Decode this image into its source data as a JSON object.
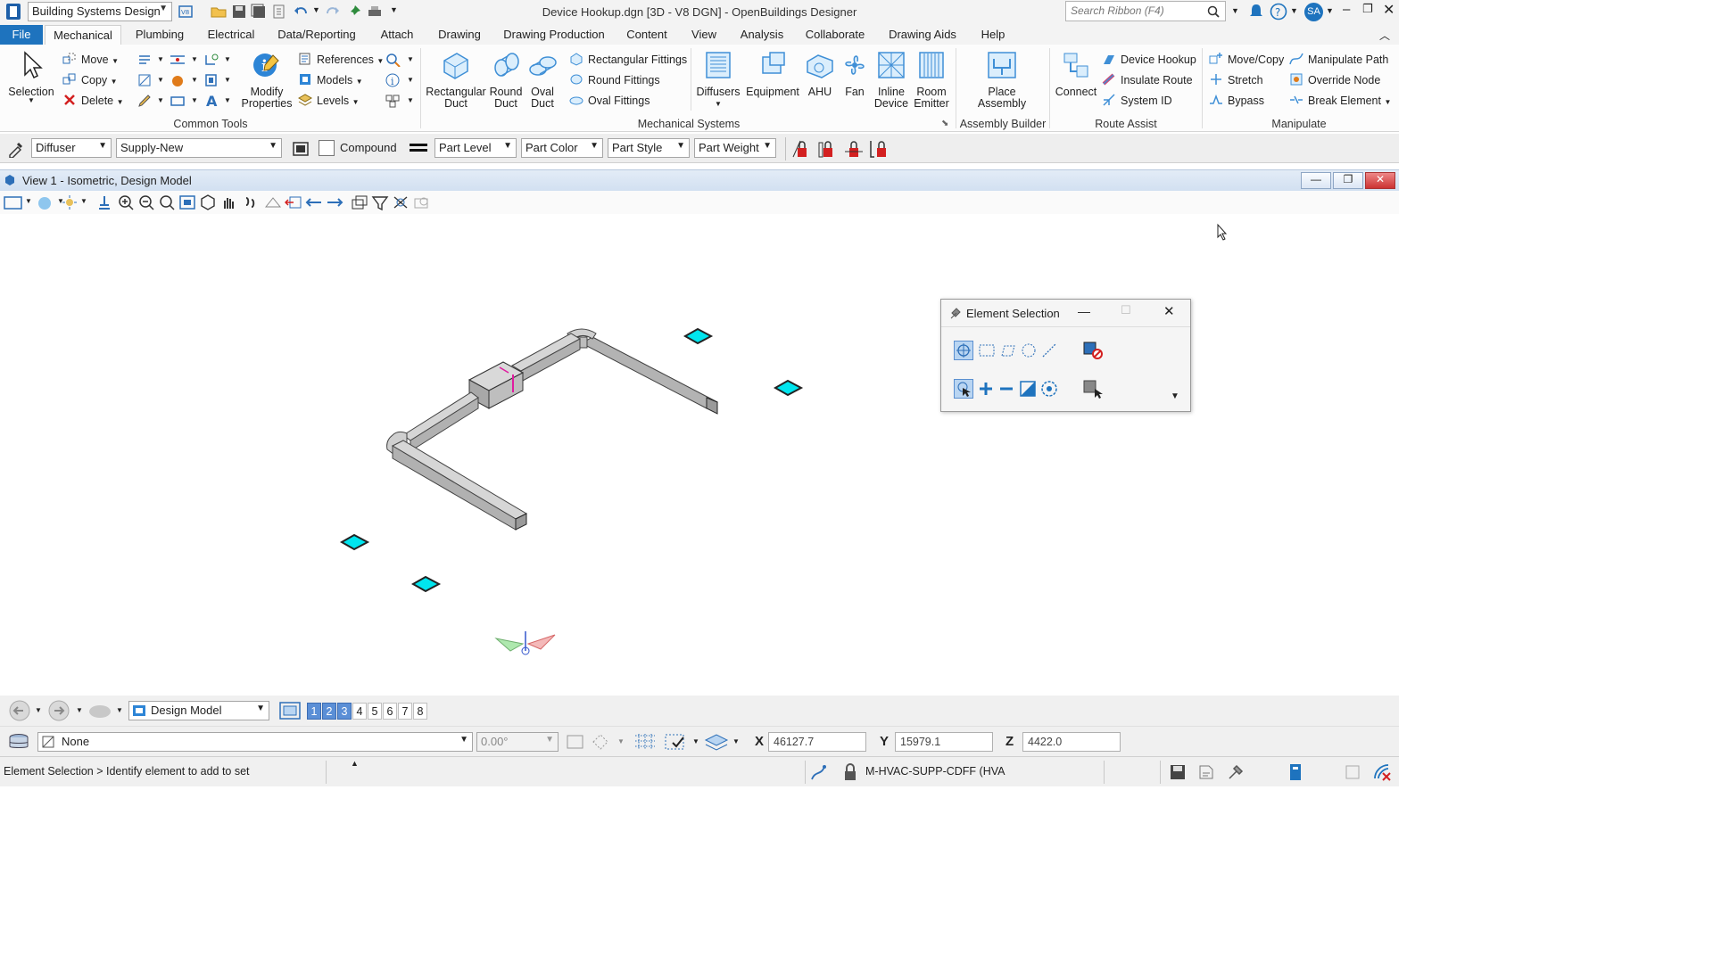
{
  "window": {
    "title": "Device Hookup.dgn [3D - V8 DGN] - OpenBuildings Designer",
    "workflow": "Building Systems Design",
    "search_placeholder": "Search Ribbon (F4)",
    "user_initials": "SA"
  },
  "tabs": [
    "File",
    "Mechanical",
    "Plumbing",
    "Electrical",
    "Data/Reporting",
    "Attach",
    "Drawing",
    "Drawing Production",
    "Content",
    "View",
    "Analysis",
    "Collaborate",
    "Drawing Aids",
    "Help"
  ],
  "active_tab": "Mechanical",
  "ribbon": {
    "common_tools": {
      "label": "Common Tools",
      "selection": "Selection",
      "move": "Move",
      "copy": "Copy",
      "delete": "Delete",
      "modify_properties": "Modify Properties",
      "references": "References",
      "models": "Models",
      "levels": "Levels"
    },
    "mechanical_systems": {
      "label": "Mechanical Systems",
      "rectangular_duct": "Rectangular Duct",
      "round_duct": "Round Duct",
      "oval_duct": "Oval Duct",
      "rectangular_fittings": "Rectangular Fittings",
      "round_fittings": "Round Fittings",
      "oval_fittings": "Oval Fittings",
      "diffusers": "Diffusers",
      "equipment": "Equipment",
      "ahu": "AHU",
      "fan": "Fan",
      "inline_device": "Inline Device",
      "room_emitter": "Room Emitter"
    },
    "assembly_builder": {
      "label": "Assembly Builder",
      "place_assembly": "Place Assembly"
    },
    "route_assist": {
      "label": "Route Assist",
      "connect": "Connect",
      "device_hookup": "Device Hookup",
      "insulate_route": "Insulate Route",
      "system_id": "System ID"
    },
    "manipulate": {
      "label": "Manipulate",
      "move_copy": "Move/Copy",
      "stretch": "Stretch",
      "bypass": "Bypass",
      "manipulate_path": "Manipulate Path",
      "override_node": "Override Node",
      "break_element": "Break Element"
    }
  },
  "attributes": {
    "part_type": "Diffuser",
    "system": "Supply-New",
    "compound": "Compound",
    "part_level": "Part Level",
    "part_color": "Part Color",
    "part_style": "Part Style",
    "part_weight": "Part Weight"
  },
  "view": {
    "title": "View 1 - Isometric, Design Model"
  },
  "element_selection": {
    "title": "Element Selection"
  },
  "nav": {
    "model": "Design Model",
    "views": [
      "1",
      "2",
      "3",
      "4",
      "5",
      "6",
      "7",
      "8"
    ],
    "active_views": [
      "1",
      "2",
      "3"
    ]
  },
  "level_bar": {
    "level": "None",
    "angle": "0.00°",
    "x_label": "X",
    "x": "46127.7",
    "y_label": "Y",
    "y": "15979.1",
    "z_label": "Z",
    "z": "4422.0"
  },
  "status": {
    "prompt": "Element Selection > Identify element to add to set",
    "active_level": "M-HVAC-SUPP-CDFF (HVA"
  },
  "colors": {
    "accent": "#1e73be",
    "diffuser": "#00e5ee",
    "duct": "#c8c8c8"
  }
}
